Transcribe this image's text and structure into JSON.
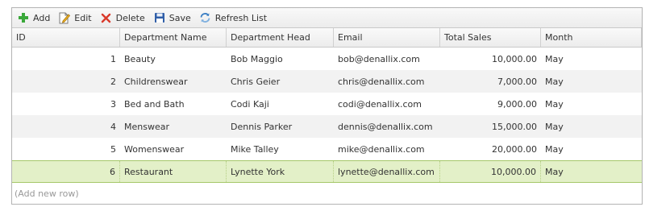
{
  "toolbar": {
    "add_label": "Add",
    "edit_label": "Edit",
    "delete_label": "Delete",
    "save_label": "Save",
    "refresh_label": "Refresh List",
    "icons": [
      "plus-icon",
      "edit-icon",
      "delete-icon",
      "save-icon",
      "refresh-icon"
    ],
    "colors": {
      "add": "#3aa83a",
      "delete": "#d93a2b",
      "save": "#2f5ea8",
      "refresh": "#3b7fc4"
    }
  },
  "grid": {
    "columns": [
      "ID",
      "Department Name",
      "Department Head",
      "Email",
      "Total Sales",
      "Month"
    ],
    "rows": [
      {
        "id": "1",
        "dept": "Beauty",
        "head": "Bob Maggio",
        "email": "bob@denallix.com",
        "sales": "10,000.00",
        "month": "May"
      },
      {
        "id": "2",
        "dept": "Childrenswear",
        "head": "Chris Geier",
        "email": "chris@denallix.com",
        "sales": "7,000.00",
        "month": "May"
      },
      {
        "id": "3",
        "dept": "Bed and Bath",
        "head": "Codi Kaji",
        "email": "codi@denallix.com",
        "sales": "9,000.00",
        "month": "May"
      },
      {
        "id": "4",
        "dept": "Menswear",
        "head": "Dennis Parker",
        "email": "dennis@denallix.com",
        "sales": "15,000.00",
        "month": "May"
      },
      {
        "id": "5",
        "dept": "Womenswear",
        "head": "Mike Talley",
        "email": "mike@denallix.com",
        "sales": "20,000.00",
        "month": "May"
      },
      {
        "id": "6",
        "dept": "Restaurant",
        "head": "Lynette York",
        "email": "lynette@denallix.com",
        "sales": "10,000.00",
        "month": "May"
      }
    ],
    "selected_row": 6,
    "selected_color": "#e3f0c8",
    "add_row_label": "(Add new row)"
  }
}
